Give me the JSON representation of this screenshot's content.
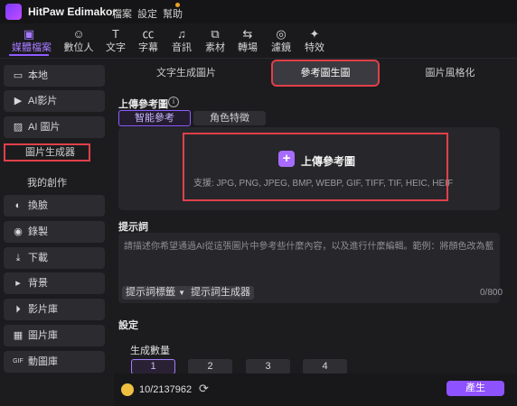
{
  "app": {
    "title": "HitPaw Edimakor",
    "menu": [
      "檔案",
      "設定",
      "幫助"
    ]
  },
  "toolbar": [
    {
      "label": "媒體檔案",
      "icon": "folder-icon"
    },
    {
      "label": "數位人",
      "icon": "avatar-icon"
    },
    {
      "label": "文字",
      "icon": "text-icon"
    },
    {
      "label": "字幕",
      "icon": "captions-icon"
    },
    {
      "label": "音訊",
      "icon": "music-icon"
    },
    {
      "label": "素材",
      "icon": "sticker-icon"
    },
    {
      "label": "轉場",
      "icon": "transition-icon"
    },
    {
      "label": "濾鏡",
      "icon": "filter-icon"
    },
    {
      "label": "特效",
      "icon": "effects-icon"
    }
  ],
  "sidebar": {
    "items": [
      {
        "label": "本地",
        "icon": "folder-icon"
      },
      {
        "label": "AI影片",
        "icon": "ai-video-icon"
      },
      {
        "label": "AI 圖片",
        "icon": "image-icon"
      },
      {
        "label": "換臉",
        "icon": "face-swap-icon"
      },
      {
        "label": "錄製",
        "icon": "record-icon"
      },
      {
        "label": "下載",
        "icon": "download-icon"
      },
      {
        "label": "背景",
        "icon": "play-triangle-icon"
      },
      {
        "label": "影片庫",
        "icon": "video-library-icon"
      },
      {
        "label": "圖片庫",
        "icon": "image-library-icon"
      },
      {
        "label": "動圖庫",
        "icon": "gif-icon"
      }
    ],
    "sub": {
      "image_generator": "圖片生成器",
      "my_creations": "我的創作"
    }
  },
  "tabs": [
    "文字生成圖片",
    "參考圖生圖",
    "圖片風格化"
  ],
  "upload": {
    "section_label": "上傳參考圖",
    "modes": [
      "智能參考",
      "角色特徵"
    ],
    "button": "上傳參考圖",
    "formats": "支援: JPG, PNG, JPEG, BMP, WEBP, GIF, TIFF, TIF, HEIC, HEIF"
  },
  "prompt": {
    "label": "提示詞",
    "placeholder": "請描述你希望通過AI從這張圖片中參考些什麼內容，以及進行什麼編輯。範例：將顏色改為藍色",
    "tags_label": "提示詞標籤",
    "generator_label": "提示詞生成器",
    "count": "0/800"
  },
  "settings": {
    "label": "設定",
    "quantity_label": "生成數量",
    "quantities": [
      "1",
      "2",
      "3",
      "4"
    ],
    "selected_quantity": "1"
  },
  "footer": {
    "credits": "10/2137962",
    "generate": "產生"
  },
  "colors": {
    "accent": "#8f52ff",
    "highlight": "#e0404a"
  }
}
